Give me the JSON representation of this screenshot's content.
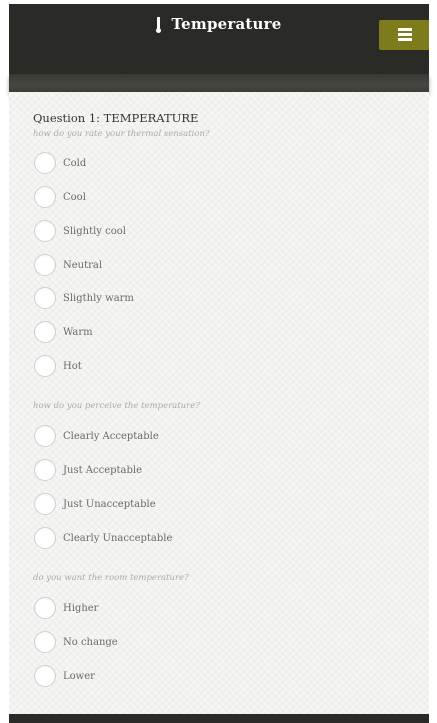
{
  "header": {
    "title": "Temperature",
    "icon": "thermometer-icon",
    "menu_icon": "menu-icon",
    "menu_color": "#7d7b1c",
    "bar_color": "#2a2a26"
  },
  "question": {
    "title": "Question 1: TEMPERATURE"
  },
  "groups": [
    {
      "prompt": "how do you rate your thermal sensation?",
      "options": [
        "Cold",
        "Cool",
        "Slightly cool",
        "Neutral",
        "Sligthly warm",
        "Warm",
        "Hot"
      ]
    },
    {
      "prompt": "how do you perceive the temperature?",
      "options": [
        "Clearly Acceptable",
        "Just Acceptable",
        "Just Unacceptable",
        "Clearly Unacceptable"
      ]
    },
    {
      "prompt": "do you want the room temperature?",
      "options": [
        "Higher",
        "No change",
        "Lower"
      ]
    }
  ]
}
